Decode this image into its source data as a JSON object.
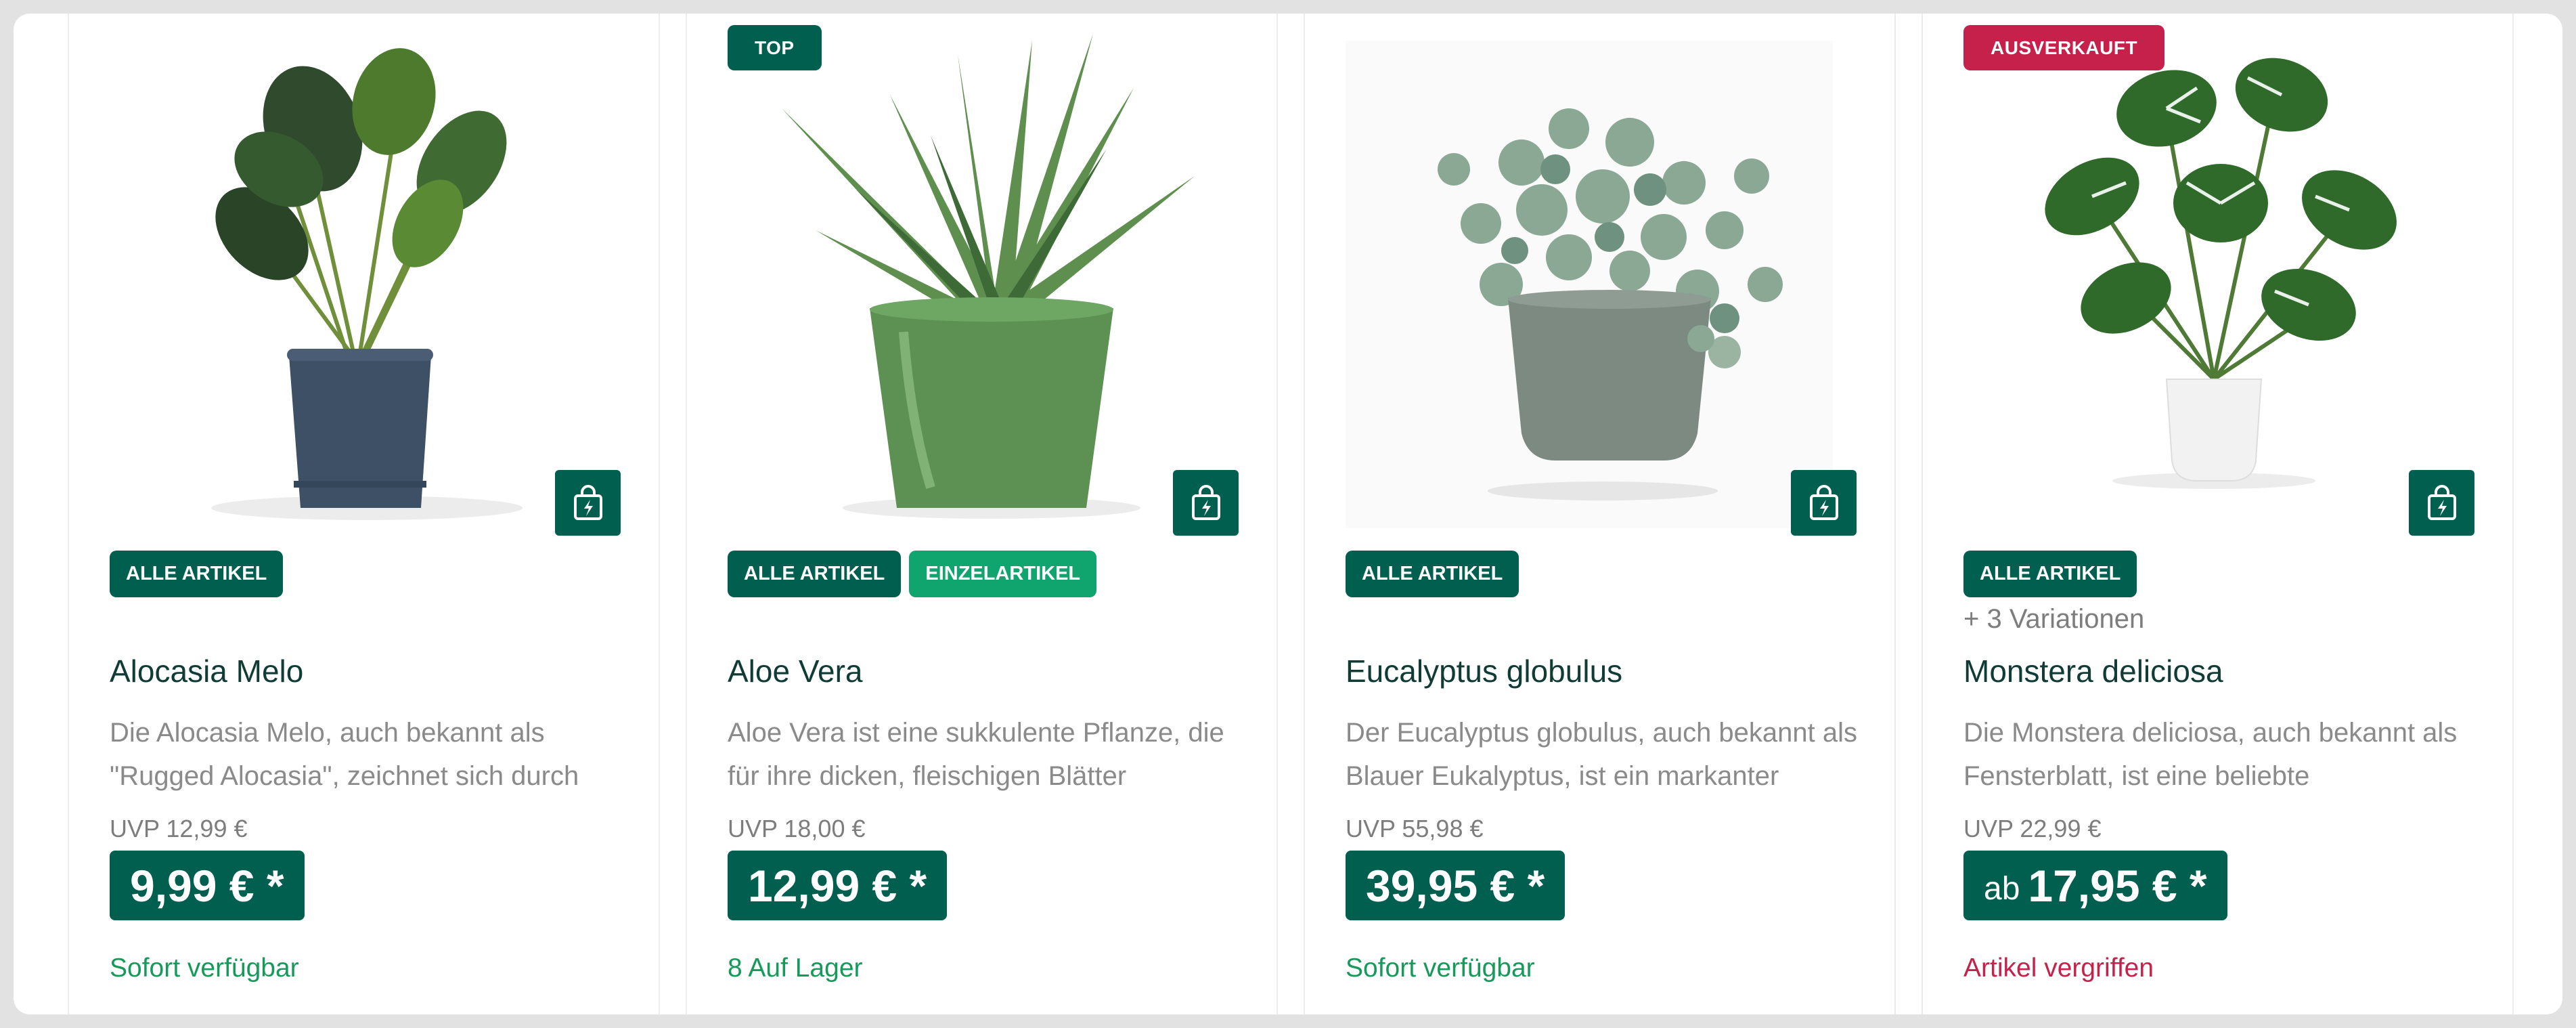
{
  "colors": {
    "primary": "#005f4f",
    "accent_green": "#10a56e",
    "sold_out_red": "#c5214b",
    "available_green": "#169a5a"
  },
  "products": [
    {
      "flag": "",
      "categories": [
        "ALLE ARTIKEL"
      ],
      "variations": "",
      "title": "Alocasia Melo",
      "description": "Die Alocasia Melo, auch bekannt als \"Rugged Alocasia\", zeichnet sich durch",
      "rrp": "UVP 12,99 €",
      "price_prefix": "",
      "price": "9,99 € *",
      "availability": "Sofort verfügbar",
      "quickbuy_icon": "shopping-bag-bolt-icon",
      "image": "plant-photo"
    },
    {
      "flag": "TOP",
      "categories": [
        "ALLE ARTIKEL",
        "EINZELARTIKEL"
      ],
      "variations": "",
      "title": "Aloe Vera",
      "description": "Aloe Vera ist eine sukkulente Pflanze, die für ihre dicken, fleischigen Blätter",
      "rrp": "UVP 18,00 €",
      "price_prefix": "",
      "price": "12,99 € *",
      "availability": "8 Auf Lager",
      "quickbuy_icon": "shopping-bag-bolt-icon",
      "image": "plant-photo"
    },
    {
      "flag": "",
      "categories": [
        "ALLE ARTIKEL"
      ],
      "variations": "",
      "title": "Eucalyptus globulus",
      "description": "Der Eucalyptus globulus, auch bekannt als Blauer Eukalyptus, ist ein markanter",
      "rrp": "UVP 55,98 €",
      "price_prefix": "",
      "price": "39,95 € *",
      "availability": "Sofort verfügbar",
      "quickbuy_icon": "shopping-bag-bolt-icon",
      "image": "plant-photo"
    },
    {
      "flag": "AUSVERKAUFT",
      "categories": [
        "ALLE ARTIKEL"
      ],
      "variations": "+ 3 Variationen",
      "title": "Monstera deliciosa",
      "description": "Die Monstera deliciosa, auch bekannt als Fensterblatt, ist eine beliebte",
      "rrp": "UVP 22,99 €",
      "price_prefix": "ab",
      "price": "17,95 € *",
      "availability": "Artikel vergriffen",
      "quickbuy_icon": "shopping-bag-bolt-icon",
      "image": "plant-photo"
    }
  ]
}
